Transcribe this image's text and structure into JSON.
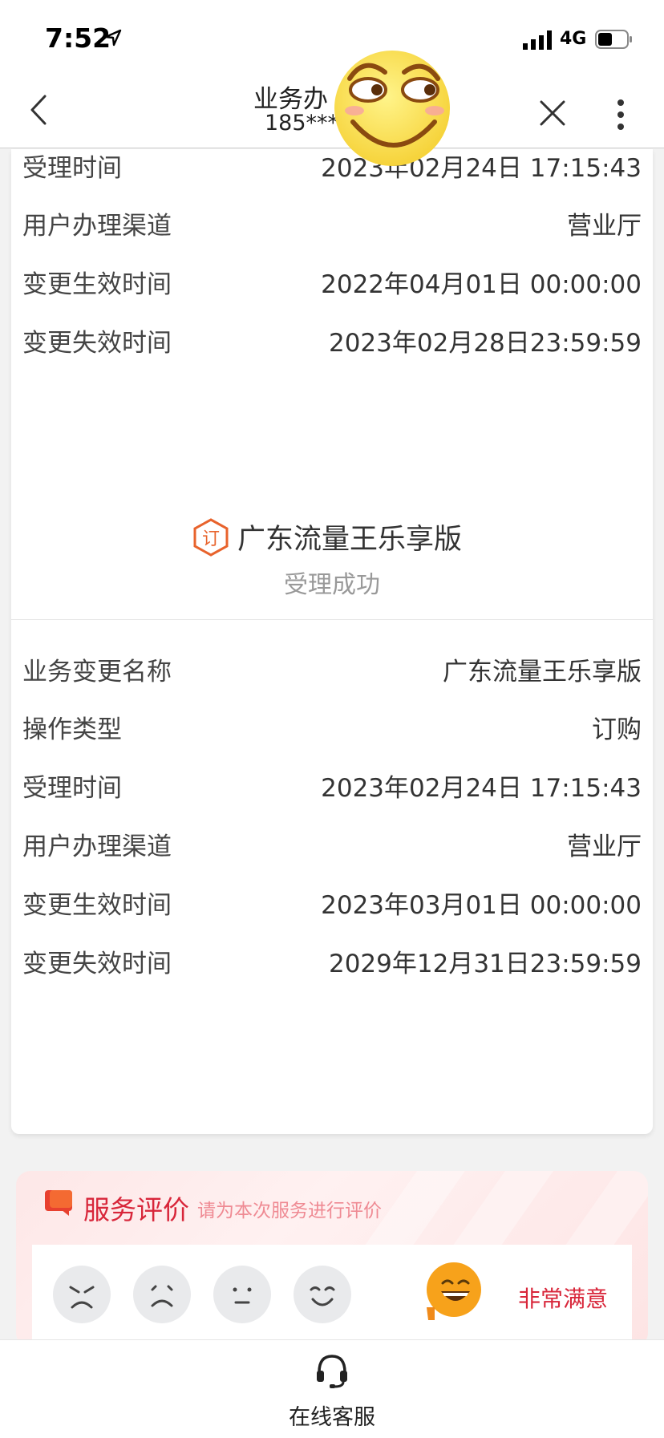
{
  "status_bar": {
    "time": "7:52",
    "network": "4G",
    "icons": [
      "location-arrow-icon",
      "signal-icon",
      "battery-icon"
    ]
  },
  "nav": {
    "title": "业务办",
    "subtitle": "185***",
    "icons": [
      "back-icon",
      "close-icon",
      "more-icon"
    ]
  },
  "record1": [
    {
      "label": "受理时间",
      "value": "2023年02月24日 17:15:43"
    },
    {
      "label": "用户办理渠道",
      "value": "营业厅"
    },
    {
      "label": "变更生效时间",
      "value": "2022年04月01日 00:00:00"
    },
    {
      "label": "变更失效时间",
      "value": "2023年02月28日23:59:59"
    }
  ],
  "business": {
    "name": "广东流量王乐享版",
    "status": "受理成功",
    "icon_char": "订"
  },
  "record2": [
    {
      "label": "业务变更名称",
      "value": "广东流量王乐享版"
    },
    {
      "label": "操作类型",
      "value": "订购"
    },
    {
      "label": "受理时间",
      "value": "2023年02月24日 17:15:43"
    },
    {
      "label": "用户办理渠道",
      "value": "营业厅"
    },
    {
      "label": "变更生效时间",
      "value": "2023年03月01日 00:00:00"
    },
    {
      "label": "变更失效时间",
      "value": "2029年12月31日23:59:59"
    }
  ],
  "evaluation": {
    "title": "服务评价",
    "hint": "请为本次服务进行评价",
    "selected_label": "非常满意",
    "options": [
      "angry-face-icon",
      "sad-face-icon",
      "neutral-face-icon",
      "smile-face-icon",
      "grin-face-icon"
    ],
    "colors": {
      "accent": "#d8263a",
      "selected_face": "#f7a21b"
    }
  },
  "bottom": {
    "label": "在线客服",
    "icon": "headset-icon"
  }
}
